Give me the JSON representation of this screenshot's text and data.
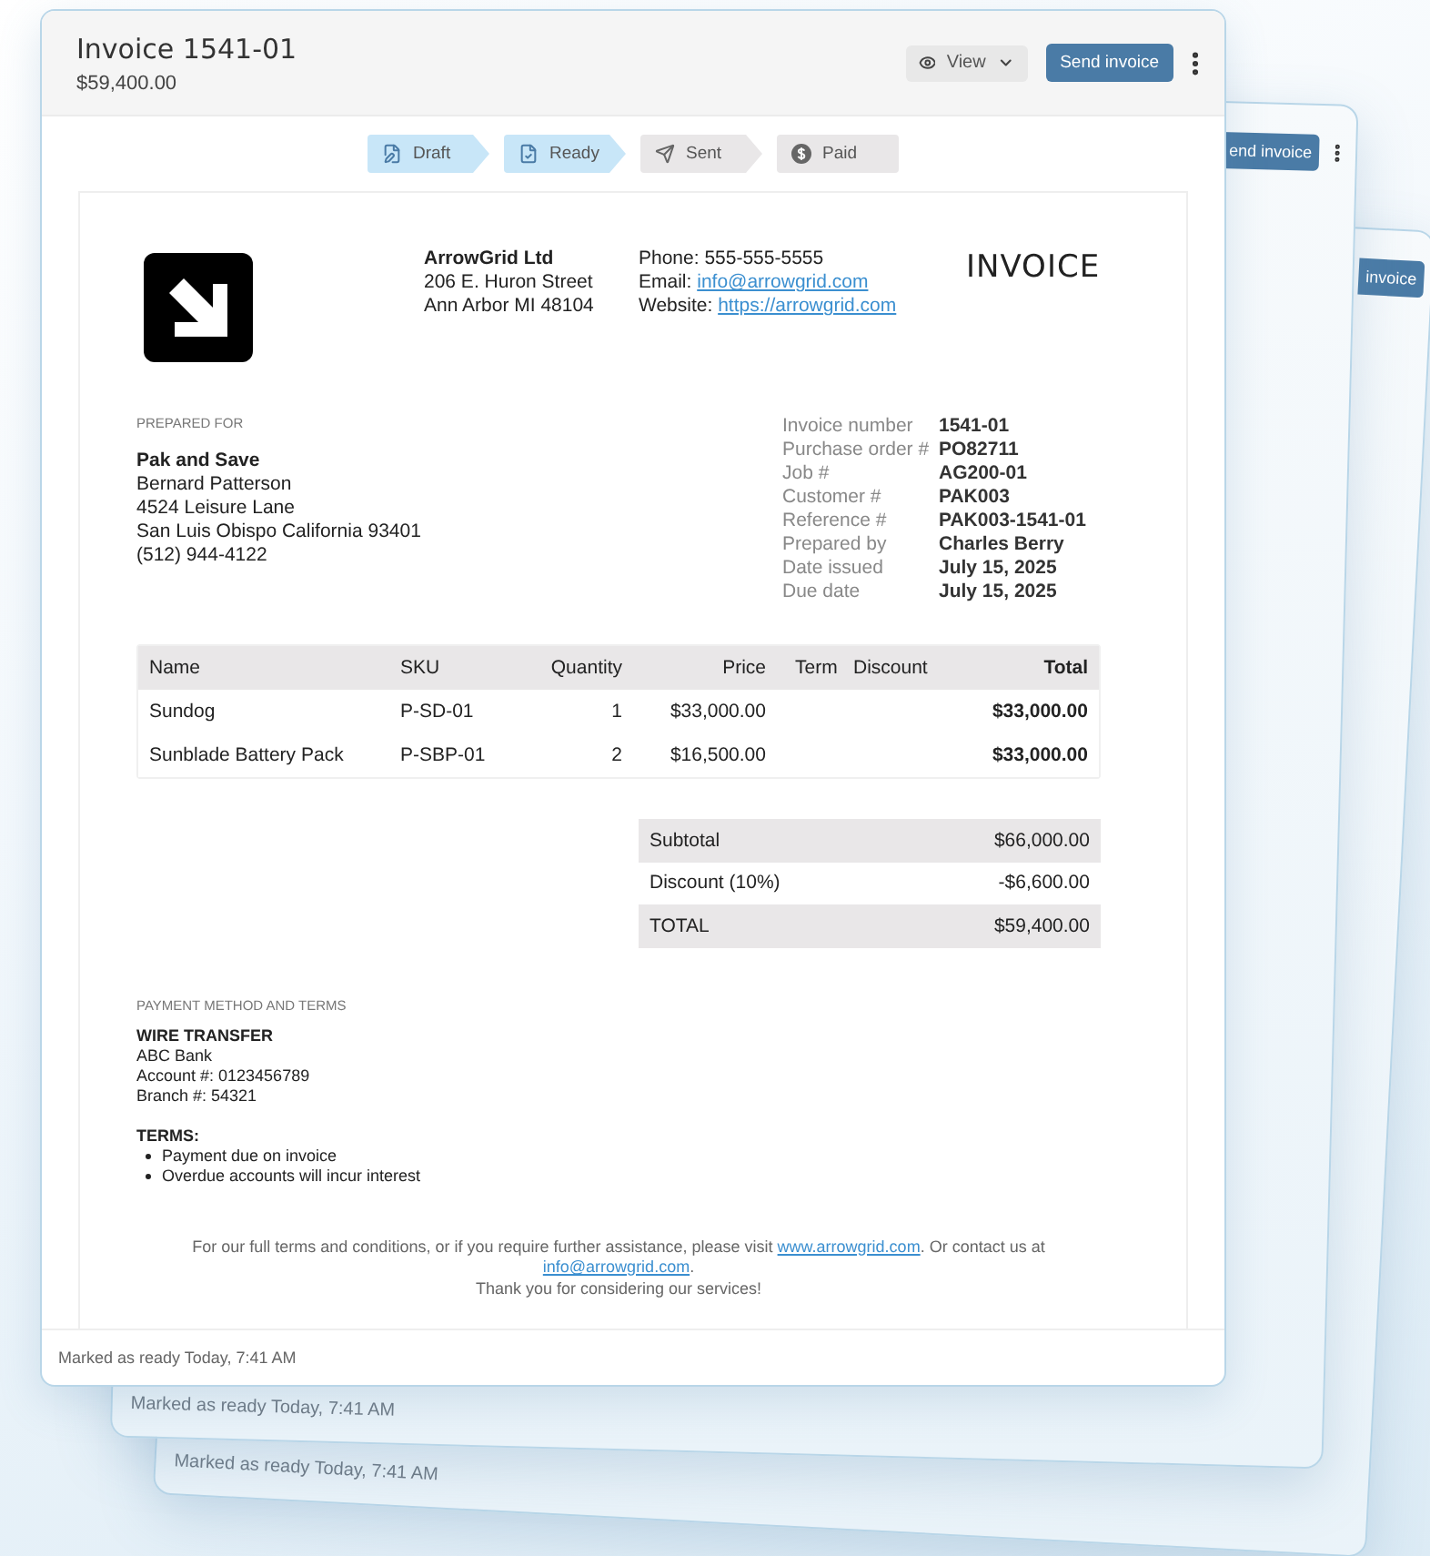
{
  "background_cards": [
    {
      "send_button": "end invoice",
      "footer": "Marked as ready Today, 7:41 AM"
    },
    {
      "send_button": "invoice",
      "footer": "Marked as ready Today, 7:41 AM"
    }
  ],
  "header": {
    "title": "Invoice 1541-01",
    "amount": "$59,400.00",
    "view_button": "View",
    "send_button": "Send invoice"
  },
  "steps": [
    {
      "label": "Draft",
      "kind": "draft",
      "done": true
    },
    {
      "label": "Ready",
      "kind": "ready",
      "done": true
    },
    {
      "label": "Sent",
      "kind": "sent",
      "done": false
    },
    {
      "label": "Paid",
      "kind": "paid",
      "done": false
    }
  ],
  "company": {
    "name": "ArrowGrid Ltd",
    "address": [
      "206 E. Huron Street",
      "Ann Arbor MI 48104"
    ]
  },
  "contact": [
    {
      "label": "Phone:",
      "value": "555-555-5555",
      "kind": "text"
    },
    {
      "label": "Email:",
      "value": "info@arrowgrid.com",
      "kind": "link"
    },
    {
      "label": "Website:",
      "value": "https://arrowgrid.com",
      "kind": "link"
    }
  ],
  "document_title": "INVOICE",
  "prepared_for": {
    "heading": "PREPARED FOR",
    "company": "Pak and Save",
    "lines": [
      "Bernard Patterson",
      "4524 Leisure Lane",
      "San Luis Obispo California 93401",
      "(512) 944-4122"
    ]
  },
  "details": [
    {
      "label": "Invoice number",
      "value": "1541-01"
    },
    {
      "label": "Purchase order #",
      "value": "PO82711"
    },
    {
      "label": "Job #",
      "value": "AG200-01"
    },
    {
      "label": "Customer #",
      "value": "PAK003"
    },
    {
      "label": "Reference #",
      "value": "PAK003-1541-01"
    },
    {
      "label": "Prepared by",
      "value": "Charles Berry"
    },
    {
      "label": "Date issued",
      "value": "July 15, 2025"
    },
    {
      "label": "Due date",
      "value": "July 15, 2025"
    }
  ],
  "table": {
    "columns": [
      "Name",
      "SKU",
      "Quantity",
      "Price",
      "Term",
      "Discount",
      "Total"
    ],
    "rows": [
      [
        "Sundog",
        "P-SD-01",
        "1",
        "$33,000.00",
        "",
        "",
        "$33,000.00"
      ],
      [
        "Sunblade Battery Pack",
        "P-SBP-01",
        "2",
        "$16,500.00",
        "",
        "",
        "$33,000.00"
      ]
    ]
  },
  "totals": [
    {
      "label": "Subtotal",
      "value": "$66,000.00"
    },
    {
      "label": "Discount (10%)",
      "value": "-$6,600.00"
    },
    {
      "label": "TOTAL",
      "value": "$59,400.00"
    }
  ],
  "payment": {
    "heading": "PAYMENT METHOD AND TERMS",
    "method": "WIRE TRANSFER",
    "lines": [
      "ABC Bank",
      "Account #: 0123456789",
      "Branch #: 54321"
    ],
    "terms_heading": "TERMS:",
    "terms": [
      "Payment due on invoice",
      "Overdue accounts will incur interest"
    ]
  },
  "footer_note": {
    "before": "For our full terms and conditions, or if you require further assistance, please visit ",
    "link": "www.arrowgrid.com",
    "middle": ". Or contact us at ",
    "email": "info@arrowgrid.com",
    "after": ".",
    "thanks": "Thank you for considering our services!"
  },
  "status": "Marked as ready Today, 7:41 AM"
}
